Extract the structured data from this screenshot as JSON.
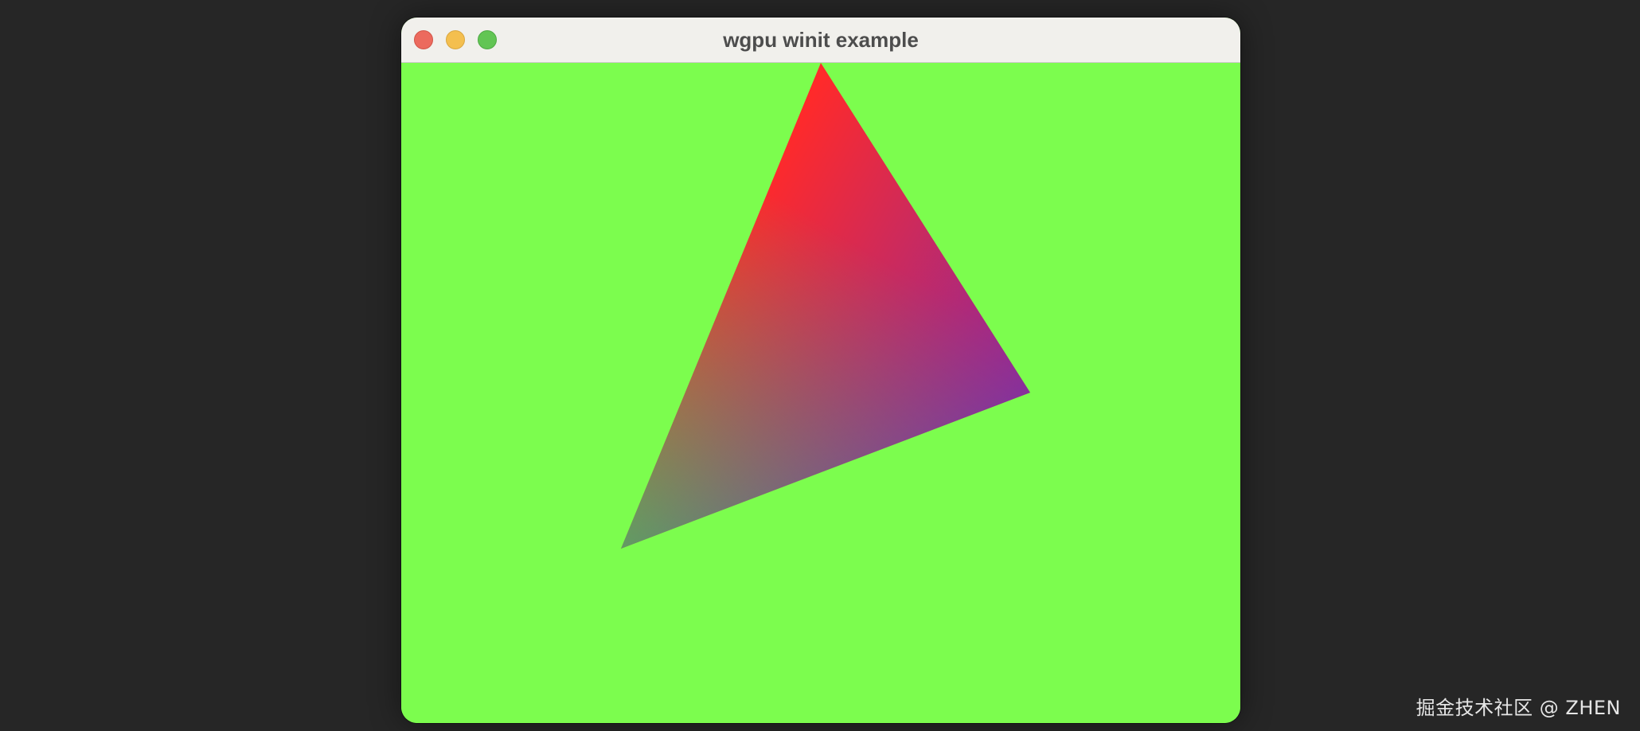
{
  "window": {
    "title": "wgpu winit example",
    "buttons": {
      "close": "close",
      "minimize": "minimize",
      "zoom": "zoom"
    },
    "background_color": "#7cfd4e"
  },
  "canvas": {
    "triangle": {
      "vertex_colors": [
        "#ff3333",
        "#1a1aff",
        "#7cfd4e"
      ]
    }
  },
  "watermark": {
    "text": "掘金技术社区 @ ZHEN"
  }
}
